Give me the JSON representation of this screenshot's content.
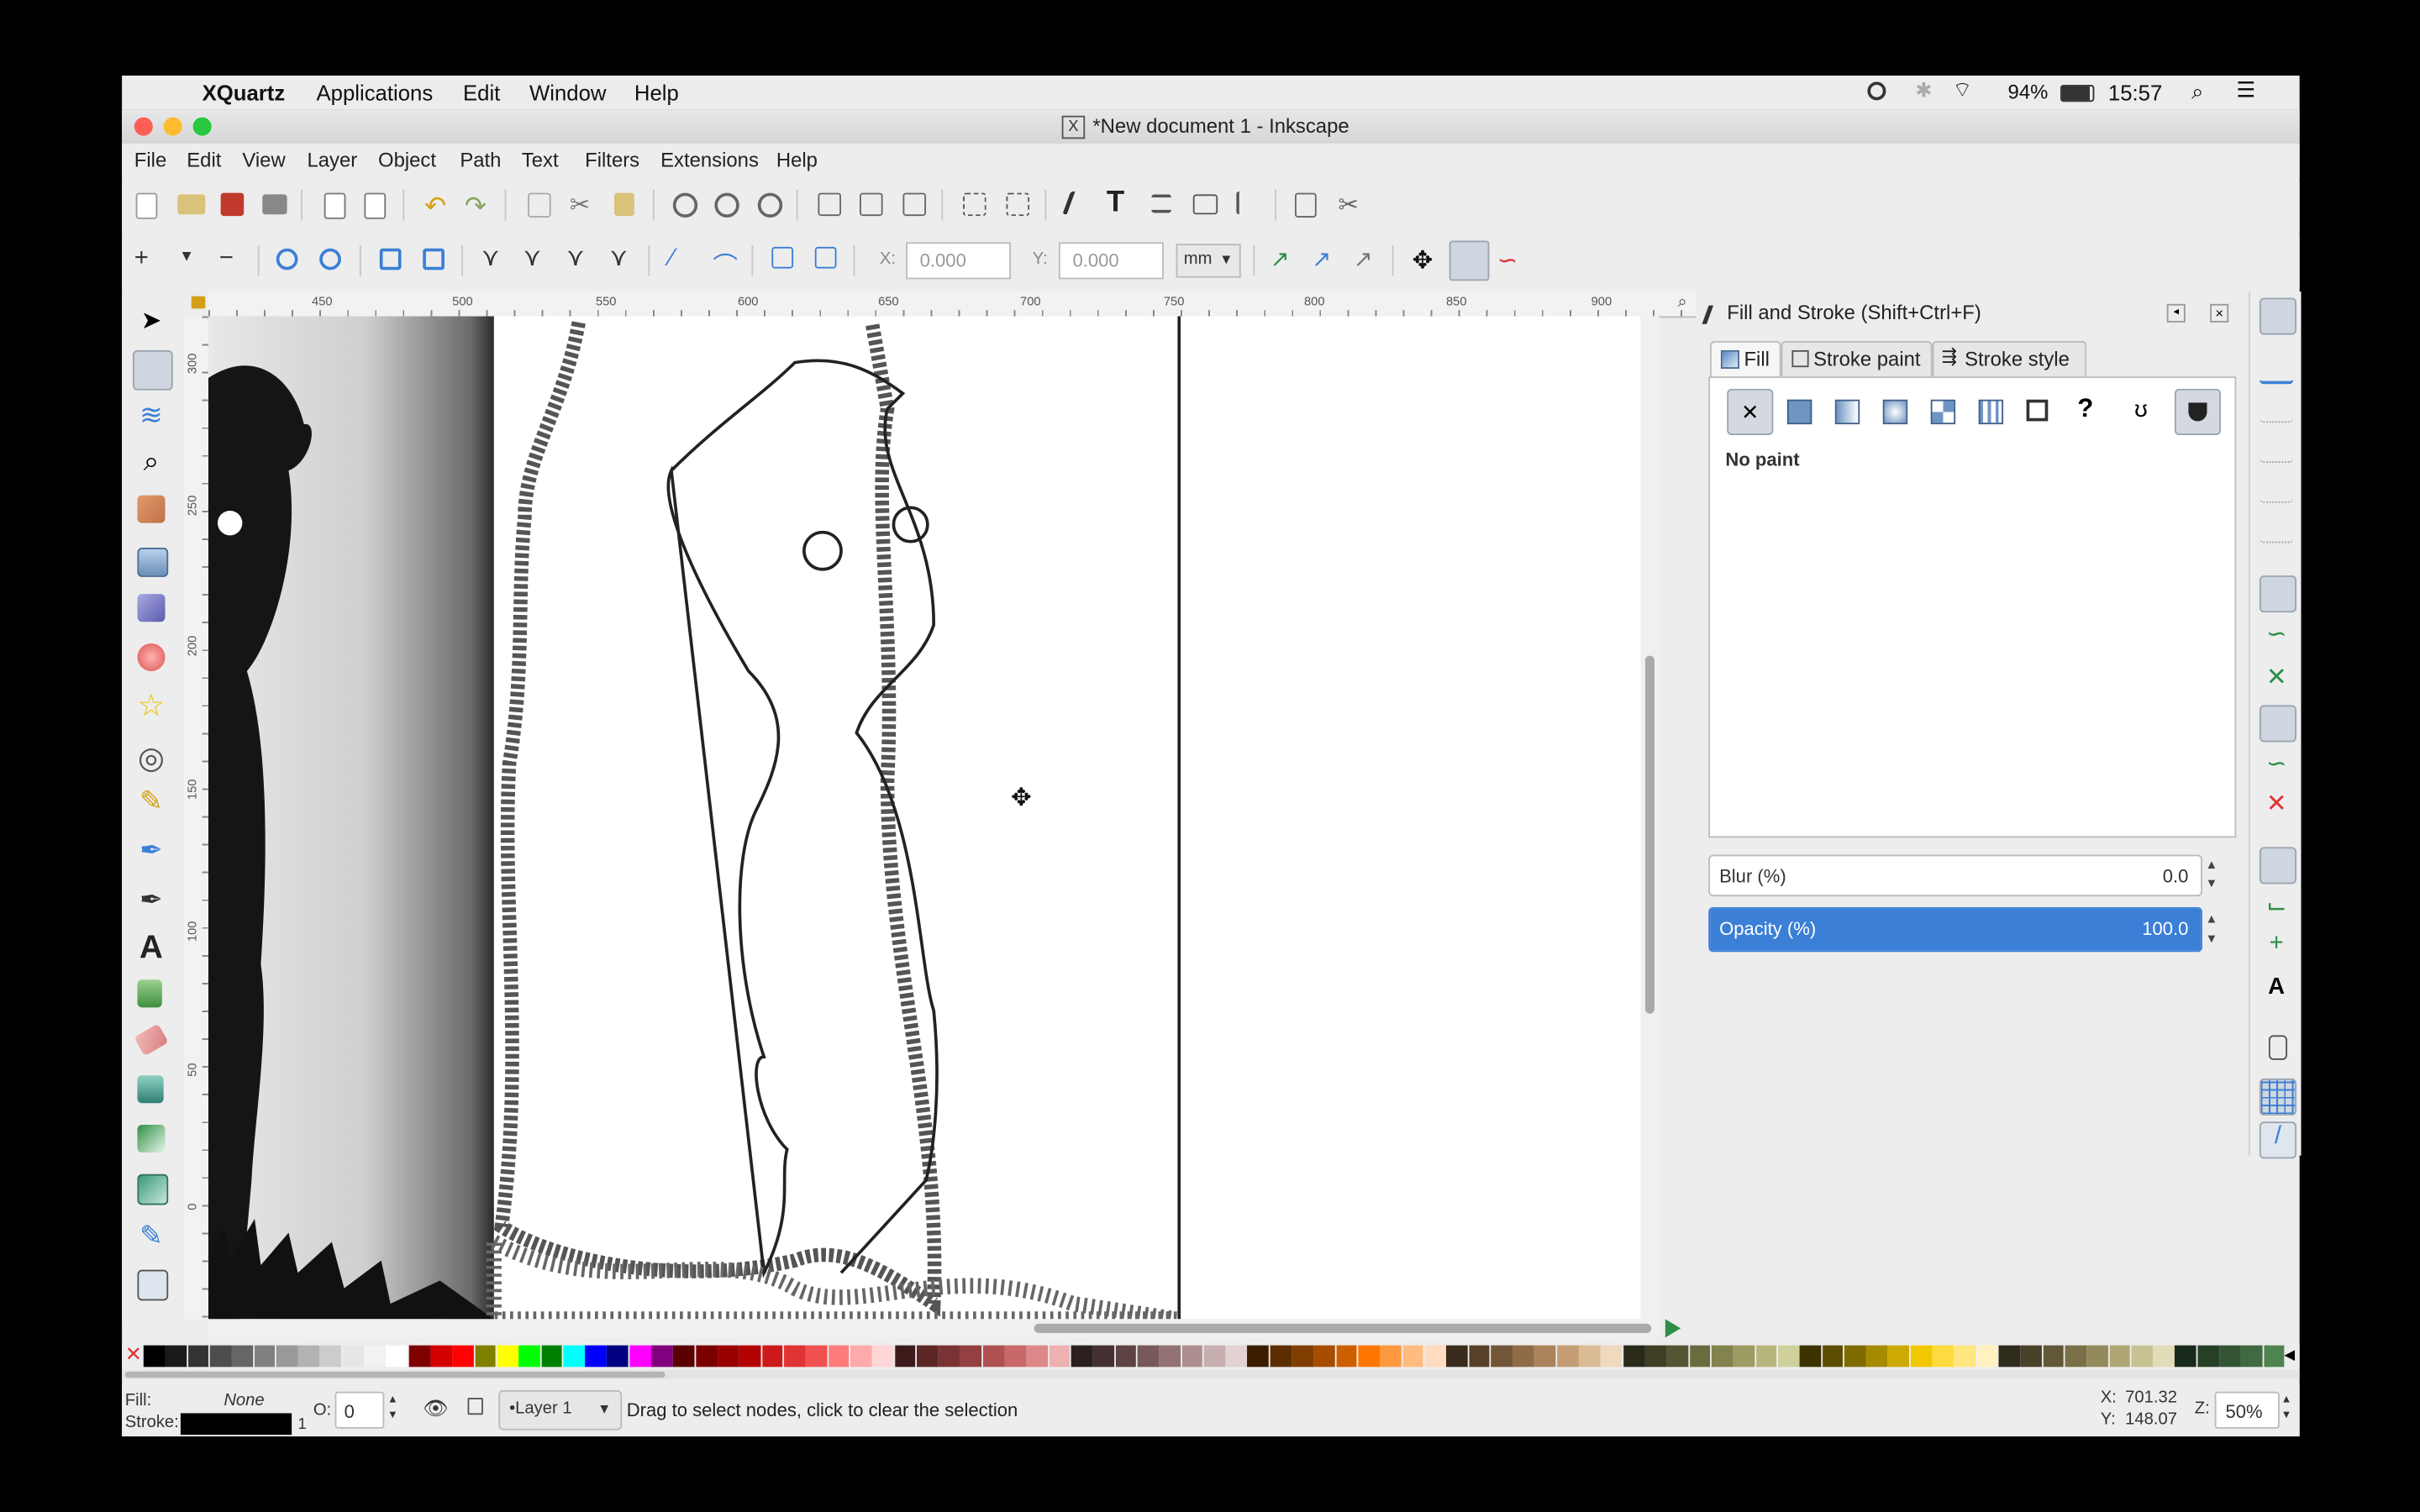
{
  "menubar": {
    "apple": "",
    "app_name": "XQuartz",
    "items": [
      "Applications",
      "Edit",
      "Window",
      "Help"
    ],
    "battery": "94%",
    "clock": "15:57"
  },
  "window": {
    "title": "*New document 1 - Inkscape",
    "menu": [
      "File",
      "Edit",
      "View",
      "Layer",
      "Object",
      "Path",
      "Text",
      "Filters",
      "Extensions",
      "Help"
    ]
  },
  "node_toolbar": {
    "x_label": "X:",
    "x_value": "0.000",
    "y_label": "Y:",
    "y_value": "0.000",
    "unit": "mm"
  },
  "ruler": {
    "top_ticks": [
      "450",
      "500",
      "550",
      "600",
      "650",
      "700",
      "750",
      "800",
      "850",
      "900"
    ],
    "left_ticks": [
      "300",
      "250",
      "200",
      "150",
      "100",
      "50",
      "0"
    ]
  },
  "fill_stroke": {
    "title": "Fill and Stroke (Shift+Ctrl+F)",
    "tabs": [
      "Fill",
      "Stroke paint",
      "Stroke style"
    ],
    "paint_status": "No paint",
    "blur_label": "Blur (%)",
    "blur_value": "0.0",
    "opacity_label": "Opacity (%)",
    "opacity_value": "100.0",
    "opacity_fraction": 1.0
  },
  "statusbar": {
    "fill_label": "Fill:",
    "fill_value": "None",
    "stroke_label": "Stroke:",
    "stroke_width": "1",
    "opacity_label": "O:",
    "opacity_value": "0",
    "layer": "•Layer 1",
    "message": "Drag to select nodes, click to clear the selection",
    "x_label": "X:",
    "x_value": "701.32",
    "y_label": "Y:",
    "y_value": "148.07",
    "zoom_label": "Z:",
    "zoom_value": "50%"
  },
  "colors": {
    "accent": "#3b7fd6",
    "window_bg": "#ededed",
    "canvas_bg": "#ffffff",
    "selection_blue": "#3b7fd6"
  }
}
